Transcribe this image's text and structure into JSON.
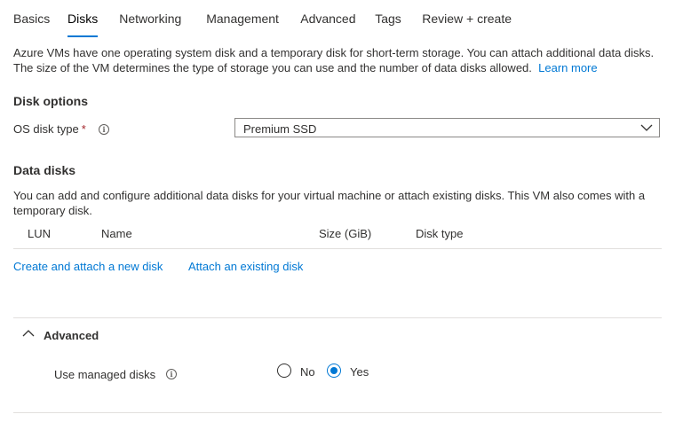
{
  "tabs": [
    {
      "label": "Basics"
    },
    {
      "label": "Disks",
      "active": true
    },
    {
      "label": "Networking"
    },
    {
      "label": "Management"
    },
    {
      "label": "Advanced"
    },
    {
      "label": "Tags"
    },
    {
      "label": "Review + create"
    }
  ],
  "intro": {
    "text": "Azure VMs have one operating system disk and a temporary disk for short-term storage. You can attach additional data disks. The size of the VM determines the type of storage you can use and the number of data disks allowed.",
    "learn_more": "Learn more"
  },
  "disk_options": {
    "heading": "Disk options",
    "os_disk_type_label": "OS disk type",
    "required_marker": "*",
    "os_disk_type_value": "Premium SSD"
  },
  "data_disks": {
    "heading": "Data disks",
    "description": "You can add and configure additional data disks for your virtual machine or attach existing disks. This VM also comes with a temporary disk.",
    "columns": [
      "LUN",
      "Name",
      "Size (GiB)",
      "Disk type"
    ],
    "create_link": "Create and attach a new disk",
    "attach_link": "Attach an existing disk"
  },
  "advanced": {
    "heading": "Advanced",
    "expanded": true,
    "managed_disks_label": "Use managed disks",
    "options": [
      "No",
      "Yes"
    ],
    "selected": "Yes"
  },
  "colors": {
    "accent": "#0078d4",
    "required": "#a4262c",
    "divider": "#e1dfdd"
  }
}
